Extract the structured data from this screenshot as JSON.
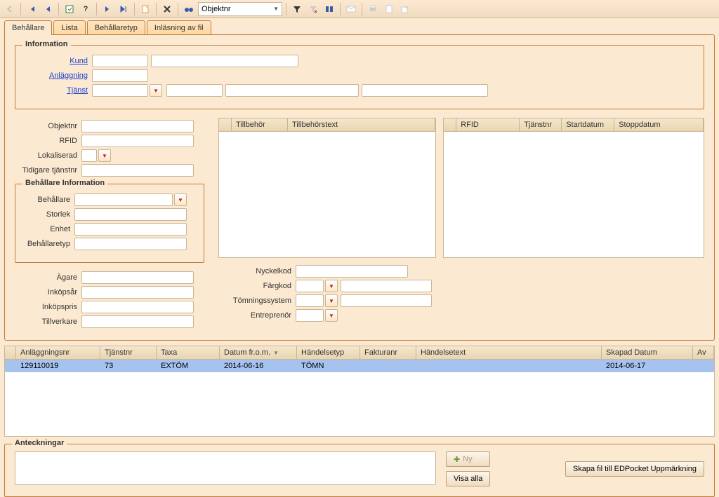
{
  "toolbar": {
    "search_select": "Objektnr"
  },
  "tabs": {
    "active": "Behållare",
    "items": [
      "Behållare",
      "Lista",
      "Behållaretyp",
      "Inläsning av fil"
    ]
  },
  "info": {
    "legend": "Information",
    "kund": "Kund",
    "anlaggning": "Anläggning",
    "tjanst": "Tjänst"
  },
  "fields": {
    "objektnr": "Objektnr",
    "rfid": "RFID",
    "lokaliserad": "Lokaliserad",
    "tidigare": "Tidigare tjänstnr",
    "behallare_legend": "Behållare Information",
    "behallare": "Behållare",
    "storlek": "Storlek",
    "enhet": "Enhet",
    "behallaretyp": "Behållaretyp",
    "agare": "Ägare",
    "inkopsar": "Inköpsår",
    "inkopspris": "Inköpspris",
    "tillverkare": "Tillverkare",
    "nyckelkod": "Nyckelkod",
    "fargkod": "Färgkod",
    "tomning": "Tömningssystem",
    "entreprenor": "Entreprenör"
  },
  "grid_tillbehor": {
    "cols": [
      "Tillbehör",
      "Tillbehörstext"
    ]
  },
  "grid_rfid": {
    "cols": [
      "RFID",
      "Tjänstnr",
      "Startdatum",
      "Stoppdatum"
    ]
  },
  "biggrid": {
    "cols": [
      "Anläggningsnr",
      "Tjänstnr",
      "Taxa",
      "Datum fr.o.m.",
      "Händelsetyp",
      "Fakturanr",
      "Händelsetext",
      "Skapad Datum",
      "Av"
    ],
    "rows": [
      {
        "anl": "129110019",
        "tjanst": "73",
        "taxa": "EXTÖM",
        "datum": "2014-06-16",
        "handelsetyp": "TÖMN",
        "faktura": "",
        "text": "",
        "skapad": "2014-06-17",
        "av": ""
      }
    ]
  },
  "notes": {
    "legend": "Anteckningar"
  },
  "buttons": {
    "ny": "Ny",
    "visa": "Visa alla",
    "skapa": "Skapa fil till EDPocket Uppmärkning"
  }
}
